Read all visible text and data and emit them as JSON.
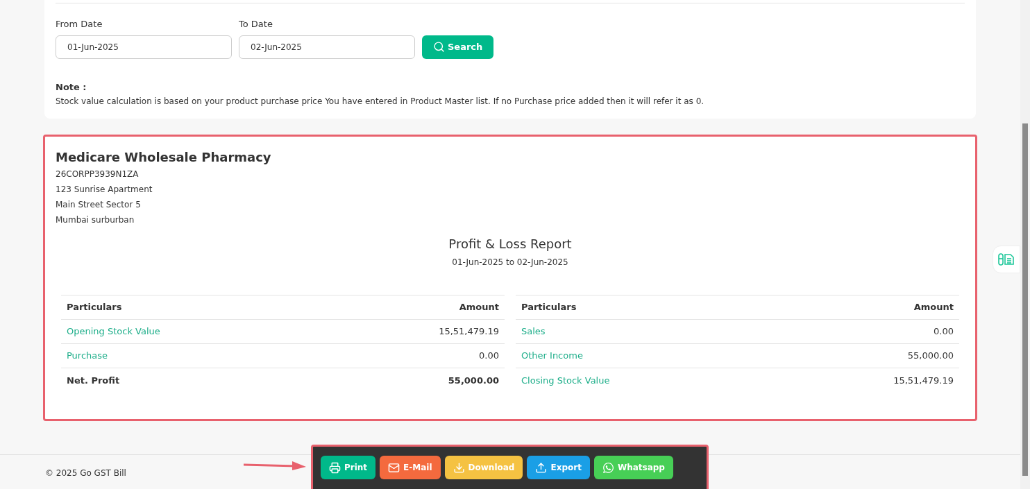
{
  "filters": {
    "from_label": "From Date",
    "from_value": "01-Jun-2025",
    "to_label": "To Date",
    "to_value": "02-Jun-2025",
    "search_button": "Search"
  },
  "note": {
    "title": "Note :",
    "text": "Stock value calculation is based on your product purchase price You have entered in Product Master list. If no Purchase price added then it will refer it as 0."
  },
  "company": {
    "name": "Medicare Wholesale Pharmacy",
    "lines": [
      "26CORPP3939N1ZA",
      "123 Sunrise Apartment",
      "Main Street Sector 5",
      "Mumbai surburban"
    ]
  },
  "report": {
    "title": "Profit & Loss Report",
    "period": "01-Jun-2025 to 02-Jun-2025"
  },
  "tables": [
    {
      "columns": [
        "Particulars",
        "Amount"
      ],
      "rows": [
        {
          "kind": "link",
          "particular": "Opening Stock Value",
          "amount": "15,51,479.19"
        },
        {
          "kind": "link",
          "particular": "Purchase",
          "amount": "0.00"
        },
        {
          "kind": "total",
          "particular": "Net. Profit",
          "amount": "55,000.00"
        }
      ]
    },
    {
      "columns": [
        "Particulars",
        "Amount"
      ],
      "rows": [
        {
          "kind": "link",
          "particular": "Sales",
          "amount": "0.00"
        },
        {
          "kind": "link",
          "particular": "Other Income",
          "amount": "55,000.00"
        },
        {
          "kind": "link",
          "particular": "Closing Stock Value",
          "amount": "15,51,479.19"
        }
      ]
    }
  ],
  "footer": {
    "copyright": "© 2025 Go GST Bill"
  },
  "actions": [
    {
      "kind": "print",
      "label": "Print",
      "color": "#00b98a"
    },
    {
      "kind": "email",
      "label": "E-Mail",
      "color": "#f46a3e"
    },
    {
      "kind": "download",
      "label": "Download",
      "color": "#f5c242"
    },
    {
      "kind": "export",
      "label": "Export",
      "color": "#1a9fe6"
    },
    {
      "kind": "whatsapp",
      "label": "Whatsapp",
      "color": "#47cf56"
    }
  ]
}
